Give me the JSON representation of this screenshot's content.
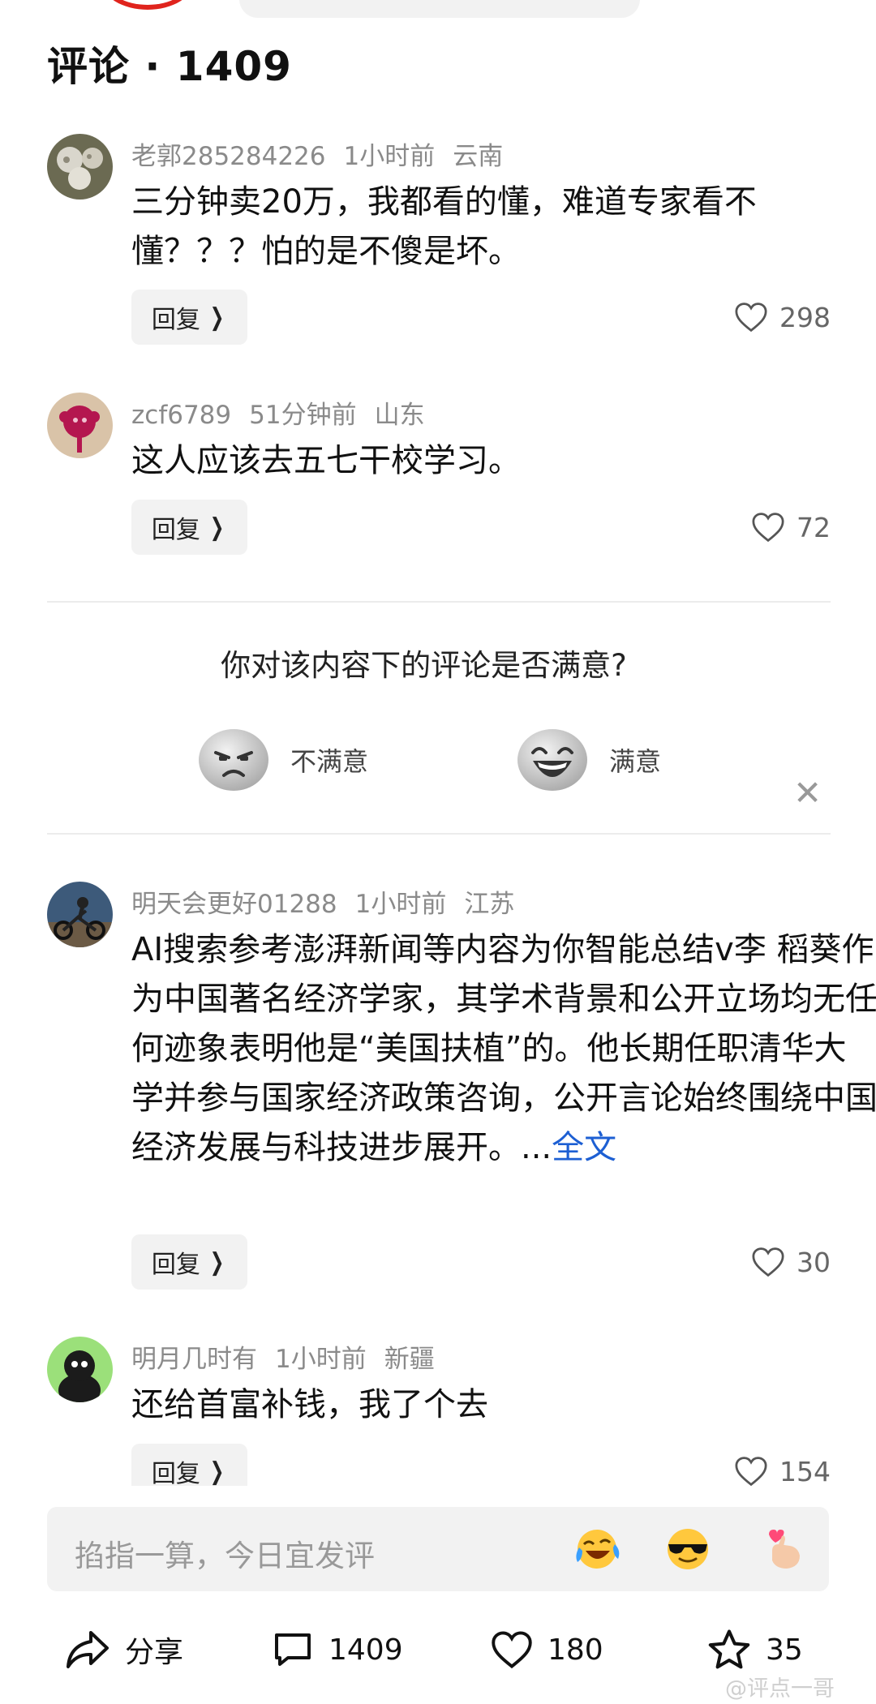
{
  "header": {
    "title": "评论 · 1409"
  },
  "comments": [
    {
      "username": "老郭285284226",
      "time": "1小时前",
      "location": "云南",
      "text": "三分钟卖20万，我都看的懂，难道专家看不懂？？？怕的是不傻是坏。",
      "more": "",
      "reply_label": "回复",
      "likes": "298"
    },
    {
      "username": "zcf6789",
      "time": "51分钟前",
      "location": "山东",
      "text": "这人应该去五七干校学习。",
      "more": "",
      "reply_label": "回复",
      "likes": "72"
    },
    {
      "username": "明天会更好01288",
      "time": "1小时前",
      "location": "江苏",
      "text": "AI搜索参考澎湃新闻等内容为你智能总结v李 稻葵作为中国著名经济学家，其学术背景和公开立场均无任何迹象表明他是“美国扶植”的。他长期任职清华大学并参与国家经济政策咨询，公开言论始终围绕中国经济发展与科技进步展开。...",
      "more": "全文",
      "reply_label": "回复",
      "likes": "30"
    },
    {
      "username": "明月几时有",
      "time": "1小时前",
      "location": "新疆",
      "text": "还给首富补钱，我了个去",
      "more": "",
      "reply_label": "回复",
      "likes": "154"
    }
  ],
  "survey": {
    "question": "你对该内容下的评论是否满意?",
    "option_bad": "不满意",
    "option_good": "满意"
  },
  "input": {
    "placeholder": "掐指一算，今日宜发评"
  },
  "bottom_bar": {
    "share_label": "分享",
    "comments_count": "1409",
    "likes_count": "180",
    "favorites_count": "35"
  },
  "watermark": "@评点一哥",
  "colors": {
    "link": "#1d5fd3",
    "meta": "#8a8a8a",
    "pill_bg": "#f2f2f2"
  }
}
